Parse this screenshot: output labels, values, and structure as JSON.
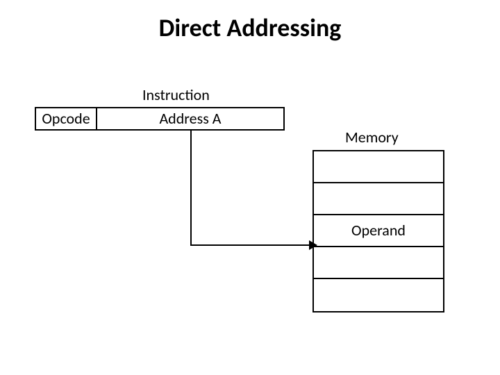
{
  "title": "Direct Addressing",
  "instruction_label": "Instruction",
  "opcode": "Opcode",
  "address": "Address A",
  "memory_label": "Memory",
  "memory_rows": [
    "",
    "",
    "Operand",
    "",
    ""
  ]
}
